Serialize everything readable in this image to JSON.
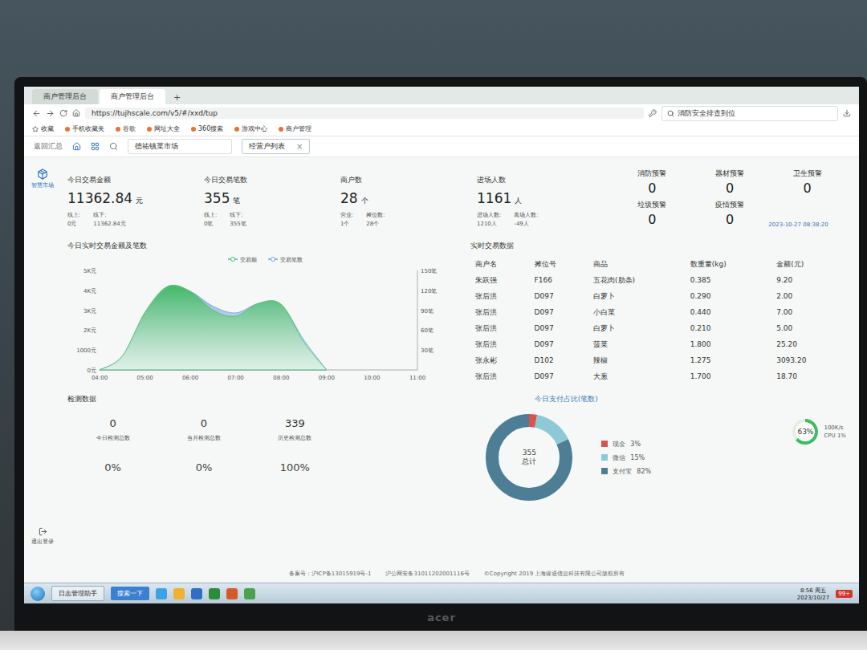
{
  "monitor": {
    "brand": "acer"
  },
  "browser": {
    "tabs": [
      {
        "label": "商户管理后台",
        "selected": false
      },
      {
        "label": "商户管理后台",
        "selected": true
      }
    ],
    "new_tab": "+",
    "url": "https://tujhscale.com/v5/#/xxd/tup",
    "search": "消防安全排查到位",
    "bookmarks": [
      "收藏",
      "手机收藏夹",
      "谷歌",
      "网址大全",
      "360搜索",
      "游戏中心",
      "商户管理"
    ]
  },
  "app": {
    "back": "返回汇总",
    "market": "德祐镇菜市场",
    "tabs": [
      {
        "label": "经营户列表",
        "selected": true,
        "close": "×"
      }
    ],
    "logo": "智慧市场",
    "logout": "退出登录"
  },
  "kpis": [
    {
      "title": "今日交易金额",
      "value": "11362.84",
      "unit": "元",
      "subs": [
        {
          "label": "线上:",
          "value": "0元"
        },
        {
          "label": "线下:",
          "value": "11362.84元"
        }
      ]
    },
    {
      "title": "今日交易笔数",
      "value": "355",
      "unit": "笔",
      "subs": [
        {
          "label": "线上:",
          "value": "0笔"
        },
        {
          "label": "线下:",
          "value": "355笔"
        }
      ]
    },
    {
      "title": "商户数",
      "value": "28",
      "unit": "个",
      "subs": [
        {
          "label": "营业:",
          "value": "1个"
        },
        {
          "label": "摊位数:",
          "value": "28个"
        }
      ]
    },
    {
      "title": "进场人数",
      "value": "1161",
      "unit": "人",
      "subs": [
        {
          "label": "进场人数:",
          "value": "1210人"
        },
        {
          "label": "离场人数:",
          "value": "-49人"
        }
      ]
    }
  ],
  "alerts": {
    "items": [
      {
        "label": "消防预警",
        "value": "0"
      },
      {
        "label": "器材预警",
        "value": "0"
      },
      {
        "label": "卫生预警",
        "value": "0"
      },
      {
        "label": "垃圾预警",
        "value": "0"
      },
      {
        "label": "疫情预警",
        "value": "0"
      }
    ],
    "time": "2023-10-27 08:38:20"
  },
  "chart": {
    "title": "今日实时交易金额及笔数",
    "left_ticks": [
      "5K元",
      "4K元",
      "3K元",
      "2K元",
      "1000元",
      "0元"
    ],
    "right_ticks": [
      "150笔",
      "120笔",
      "90笔",
      "60笔",
      "30笔"
    ],
    "x_ticks": [
      "04:00",
      "05:00",
      "06:00",
      "07:00",
      "08:00",
      "09:00",
      "10:00",
      "11:00"
    ],
    "left_max": 5000,
    "right_max": 150,
    "series": [
      {
        "name": "交易笔数",
        "axis": "right",
        "color": "#6f9fd8",
        "values": [
          0,
          20,
          85,
          122,
          118,
          96,
          86,
          100,
          98,
          45,
          0
        ]
      },
      {
        "name": "交易额",
        "axis": "left",
        "color": "#4cbb6c",
        "values": [
          0,
          700,
          2900,
          4200,
          3950,
          3000,
          2700,
          3350,
          3300,
          1400,
          0
        ]
      }
    ]
  },
  "table": {
    "title": "实时交易数据",
    "columns": [
      "商户名",
      "摊位号",
      "商品",
      "数重量(kg)",
      "金额(元)"
    ],
    "rows": [
      [
        "朱跃强",
        "F166",
        "五花肉(肋条)",
        "0.385",
        "9.20"
      ],
      [
        "张后洪",
        "D097",
        "白萝卜",
        "0.290",
        "2.00"
      ],
      [
        "张后洪",
        "D097",
        "小白菜",
        "0.440",
        "7.00"
      ],
      [
        "张后洪",
        "D097",
        "白萝卜",
        "0.210",
        "5.00"
      ],
      [
        "张后洪",
        "D097",
        "菠菜",
        "1.800",
        "25.20"
      ],
      [
        "张永彬",
        "D102",
        "辣椒",
        "1.275",
        "3093.20"
      ],
      [
        "张后洪",
        "D097",
        "大葱",
        "1.700",
        "18.70"
      ]
    ]
  },
  "inspection": {
    "title": "检测数据",
    "stats": [
      {
        "value": "0",
        "label": "今日检测总数",
        "percent": "0%"
      },
      {
        "value": "0",
        "label": "当月检测总数",
        "percent": "0%"
      },
      {
        "value": "339",
        "label": "历史检测总数",
        "percent": "100%"
      }
    ]
  },
  "payment": {
    "title": "今日支付占比(笔数)",
    "total": "355",
    "total_label": "总计",
    "segments": [
      {
        "label": "现金",
        "share": "3%",
        "value": 3,
        "color": "#d9534f"
      },
      {
        "label": "微信",
        "share": "15%",
        "value": 15,
        "color": "#8ecad6"
      },
      {
        "label": "支付宝",
        "share": "82%",
        "value": 82,
        "color": "#4e7e96"
      }
    ]
  },
  "footer": [
    "备案号：沪ICP备13015919号-1",
    "沪公网安备31011202001116号",
    "©Copyright 2019 上海缘通信息科技有限公司版权所有"
  ],
  "cpu": {
    "level": 0.63,
    "reading": "63%",
    "speed": "100K/s",
    "label": "CPU 1%"
  },
  "taskbar": {
    "items": [
      "日志管理助手"
    ],
    "search": "搜索一下",
    "time": "8:56 周五",
    "date": "2023/10/27",
    "badge": "99+"
  }
}
